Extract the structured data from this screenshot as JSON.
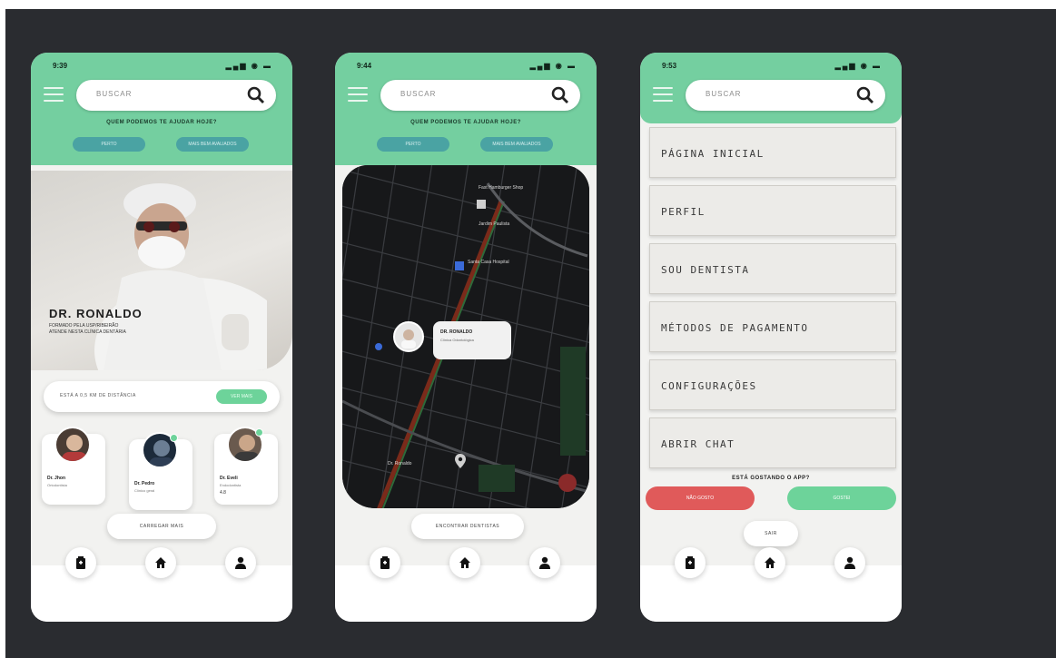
{
  "shared": {
    "search_placeholder": "BUSCAR",
    "promo_line": "QUEM PODEMOS TE AJUDAR HOJE?",
    "pill_left": "PERTO",
    "pill_right": "MAIS BEM AVALIADOS"
  },
  "phone1": {
    "time": "9:39",
    "status_icons": "▂▄▆ ◉ ▬",
    "hero_name": "DR. RONALDO",
    "hero_sub": "FORMADO PELA USP/RIBEIRÃO\nATENDE NESTA CLÍNICA DENTÁRIA",
    "banner_text": "ESTÁ A 0,5 KM DE DISTÂNCIA",
    "banner_cta": "VER MAIS",
    "doctors": [
      {
        "name": "Dr. Jhon",
        "spec": "Ortodontista",
        "rating": ""
      },
      {
        "name": "Dr. Pedro",
        "spec": "Clínico geral",
        "rating": ""
      },
      {
        "name": "Dr. Eveli",
        "spec": "Endodontista",
        "rating": "4.8"
      }
    ],
    "load_more": "CARREGAR MAIS"
  },
  "phone2": {
    "time": "9:44",
    "status_icons": "▂▄▆ ◉ ▬",
    "map_labels": [
      "Fast Hamburger Shop",
      "Jardim Paulista",
      "Santa Casa Hospital",
      "Dr. Ronaldo"
    ],
    "bubble_title": "DR. RONALDO",
    "bubble_sub": "Clínica Odontológica",
    "bottom_button": "ENCONTRAR DENTISTAS"
  },
  "phone3": {
    "time": "9:53",
    "status_icons": "▂▄▆ ◉ ▬",
    "menu": [
      "PÁGINA INICIAL",
      "PERFIL",
      "SOU DENTISTA",
      "MÉTODOS DE PAGAMENTO",
      "CONFIGURAÇÕES",
      "ABRIR CHAT"
    ],
    "question": "ESTÁ GOSTANDO O APP?",
    "no_label": "NÃO GOSTO",
    "yes_label": "GOSTEI",
    "exit_label": "SAIR"
  },
  "colors": {
    "accent": "#74cfa0",
    "teal": "#4aa3a3",
    "green": "#6dd39a",
    "red": "#e05a5a",
    "background": "#2a2c30"
  },
  "icons": [
    "menu-icon",
    "search-icon",
    "clipboard-icon",
    "home-icon",
    "user-icon",
    "map-pin-icon"
  ]
}
